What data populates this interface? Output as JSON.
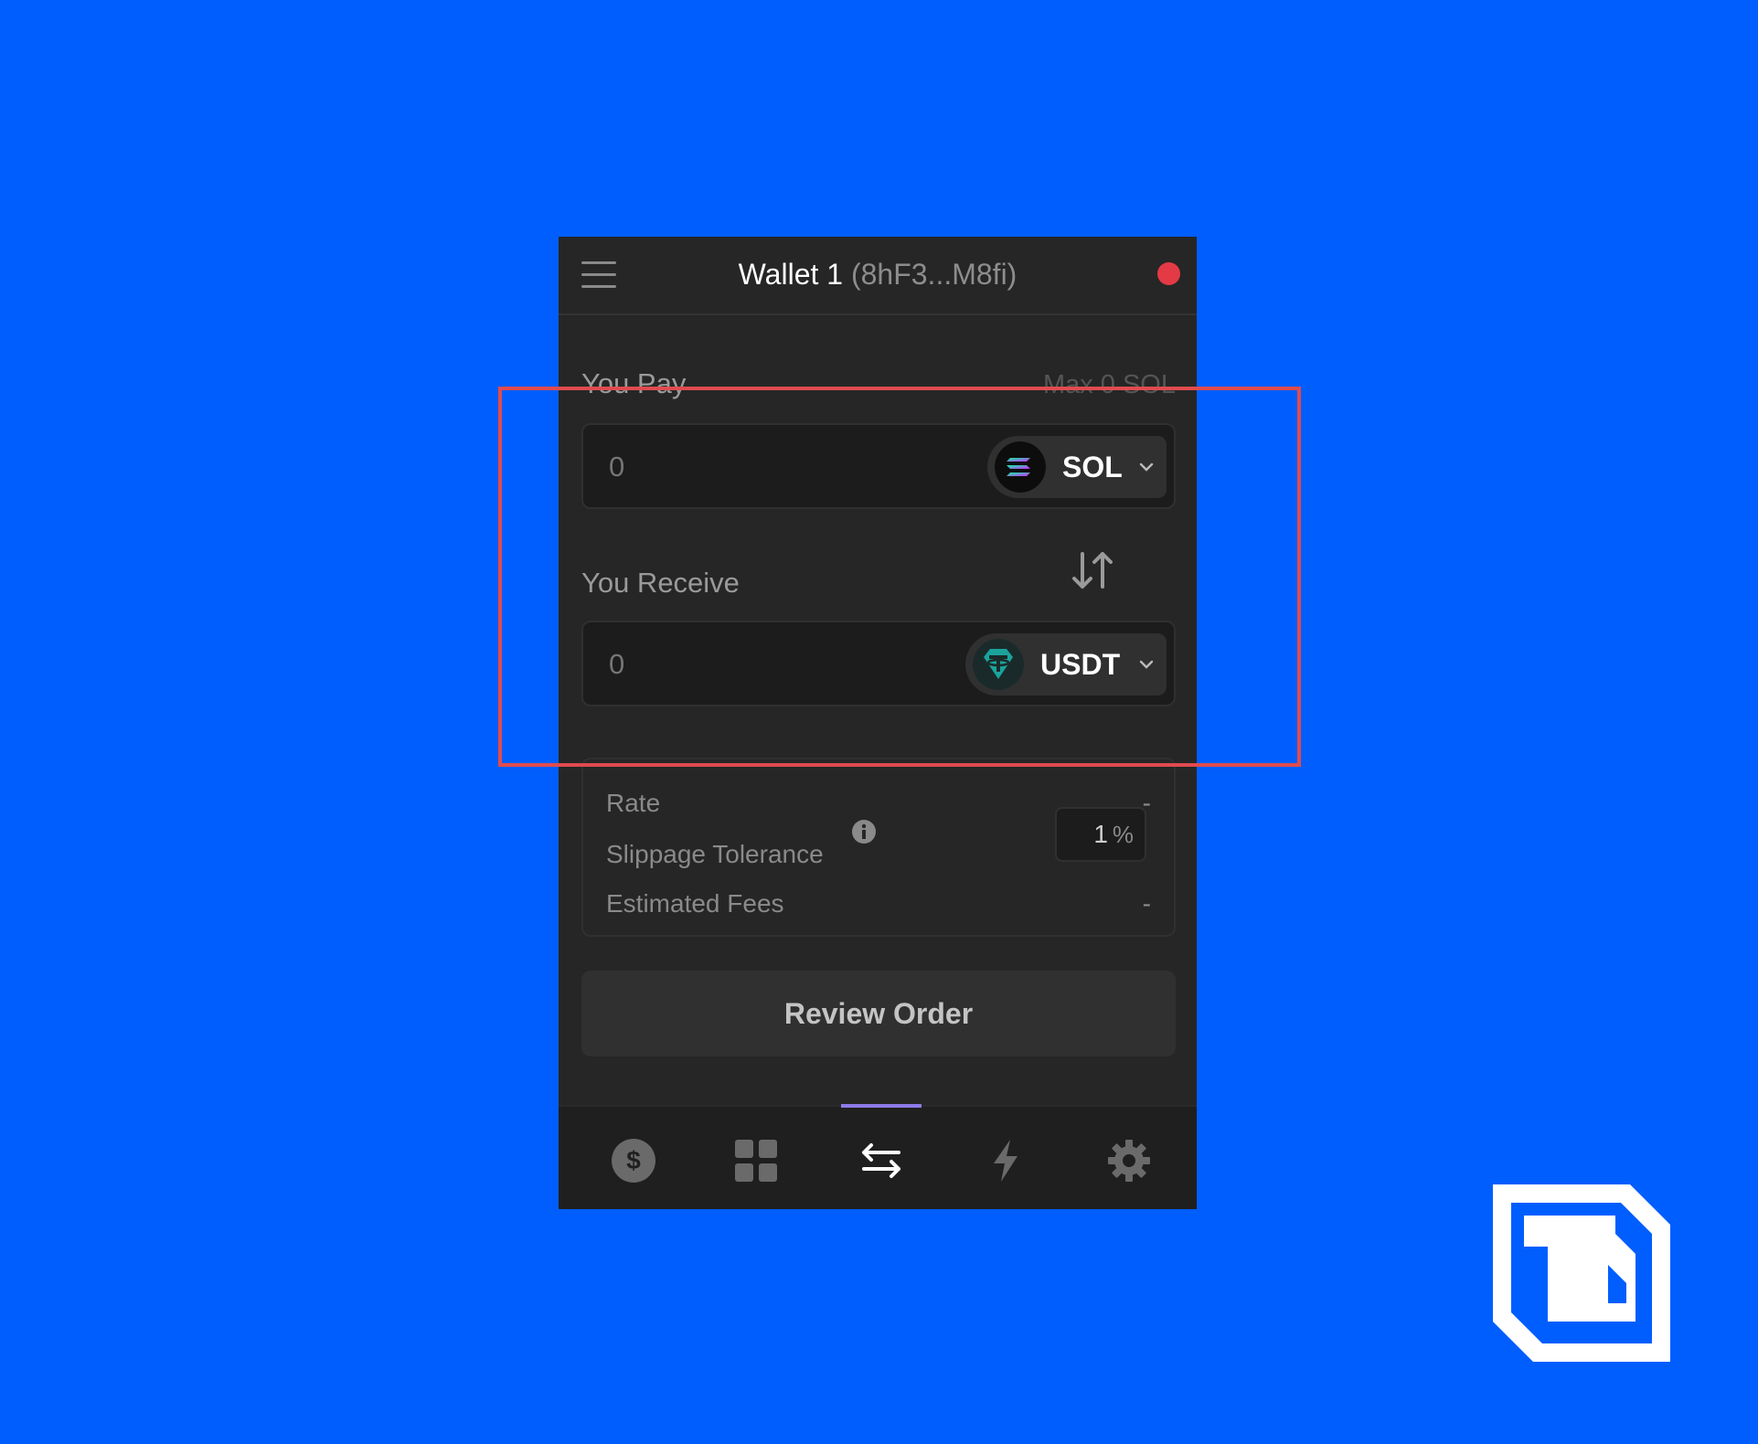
{
  "header": {
    "wallet_name": "Wallet 1",
    "wallet_address": "(8hF3...M8fi)",
    "status_color": "#E33A45"
  },
  "pay": {
    "label": "You Pay",
    "max_label": "Max 0 SOL",
    "amount_placeholder": "0",
    "token": "SOL"
  },
  "receive": {
    "label": "You Receive",
    "amount_placeholder": "0",
    "token": "USDT"
  },
  "details": {
    "rate_label": "Rate",
    "rate_value": "-",
    "slippage_label": "Slippage Tolerance",
    "slippage_value": "1",
    "slippage_unit": "%",
    "fees_label": "Estimated Fees",
    "fees_value": "-"
  },
  "review_button": "Review Order",
  "tabs": [
    {
      "icon": "dollar-icon",
      "active": false
    },
    {
      "icon": "grid-icon",
      "active": false
    },
    {
      "icon": "swap-icon",
      "active": true
    },
    {
      "icon": "lightning-icon",
      "active": false
    },
    {
      "icon": "gear-icon",
      "active": false
    }
  ],
  "colors": {
    "background": "#005EFF",
    "panel": "#262626",
    "highlight": "#E04B4E",
    "active_tab": "#8C7BEA"
  }
}
